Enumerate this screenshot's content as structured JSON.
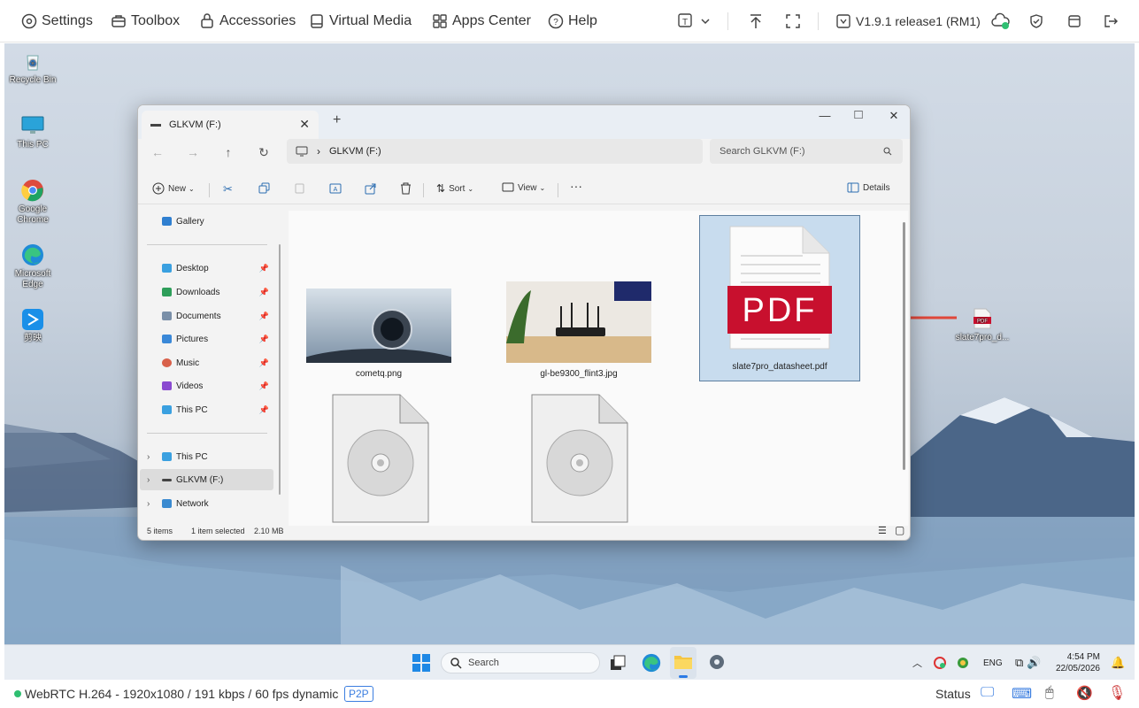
{
  "topbar": {
    "settings": "Settings",
    "toolbox": "Toolbox",
    "accessories": "Accessories",
    "virtual_media": "Virtual Media",
    "apps_center": "Apps Center",
    "help": "Help",
    "version": "V1.9.1 release1 (RM1)"
  },
  "desktop": {
    "icons": [
      {
        "label": "Recycle Bin",
        "icon": "recycle-bin-icon"
      },
      {
        "label": "This PC",
        "icon": "monitor-icon"
      },
      {
        "label": "Google Chrome",
        "icon": "chrome-icon"
      },
      {
        "label": "Microsoft Edge",
        "icon": "edge-icon"
      },
      {
        "label": "剪映",
        "icon": "capcut-icon"
      }
    ],
    "dragged_file": "slate7pro_d..."
  },
  "explorer": {
    "tab_title": "GLKVM (F:)",
    "address": "GLKVM (F:)",
    "search_placeholder": "Search GLKVM (F:)",
    "commands": {
      "new": "New",
      "sort": "Sort",
      "view": "View",
      "details": "Details"
    },
    "nav": {
      "gallery": "Gallery",
      "quick_access": [
        {
          "label": "Desktop",
          "color": "#3aa0e0"
        },
        {
          "label": "Downloads",
          "color": "#2e9e5a"
        },
        {
          "label": "Documents",
          "color": "#7a8fa8"
        },
        {
          "label": "Pictures",
          "color": "#3a88d8"
        },
        {
          "label": "Music",
          "color": "#d8604a"
        },
        {
          "label": "Videos",
          "color": "#8a4ad0"
        },
        {
          "label": "This PC",
          "color": "#3aa0e0"
        }
      ],
      "this_pc": "This PC",
      "drive": "GLKVM (F:)",
      "network": "Network"
    },
    "files": [
      {
        "name": "cometq.png"
      },
      {
        "name": "gl-be9300_flint3.jpg"
      },
      {
        "name": "slate7pro_datasheet.pdf",
        "selected": true
      }
    ],
    "pdf_label": "PDF",
    "status": {
      "items": "5 items",
      "selected": "1 item selected",
      "size": "2.10 MB"
    }
  },
  "taskbar": {
    "search": "Search",
    "lang": "ENG",
    "time": "4:54 PM",
    "date": "22/05/2026"
  },
  "bottombar": {
    "stream": "WebRTC H.264 - 1920x1080 / 191 kbps / 60 fps dynamic",
    "mode": "P2P",
    "status": "Status"
  },
  "colors": {
    "accent_green": "#2fbf71",
    "pdf_red": "#c8102e",
    "arrow_red": "#e0473a",
    "selection": "#c8dcee"
  }
}
